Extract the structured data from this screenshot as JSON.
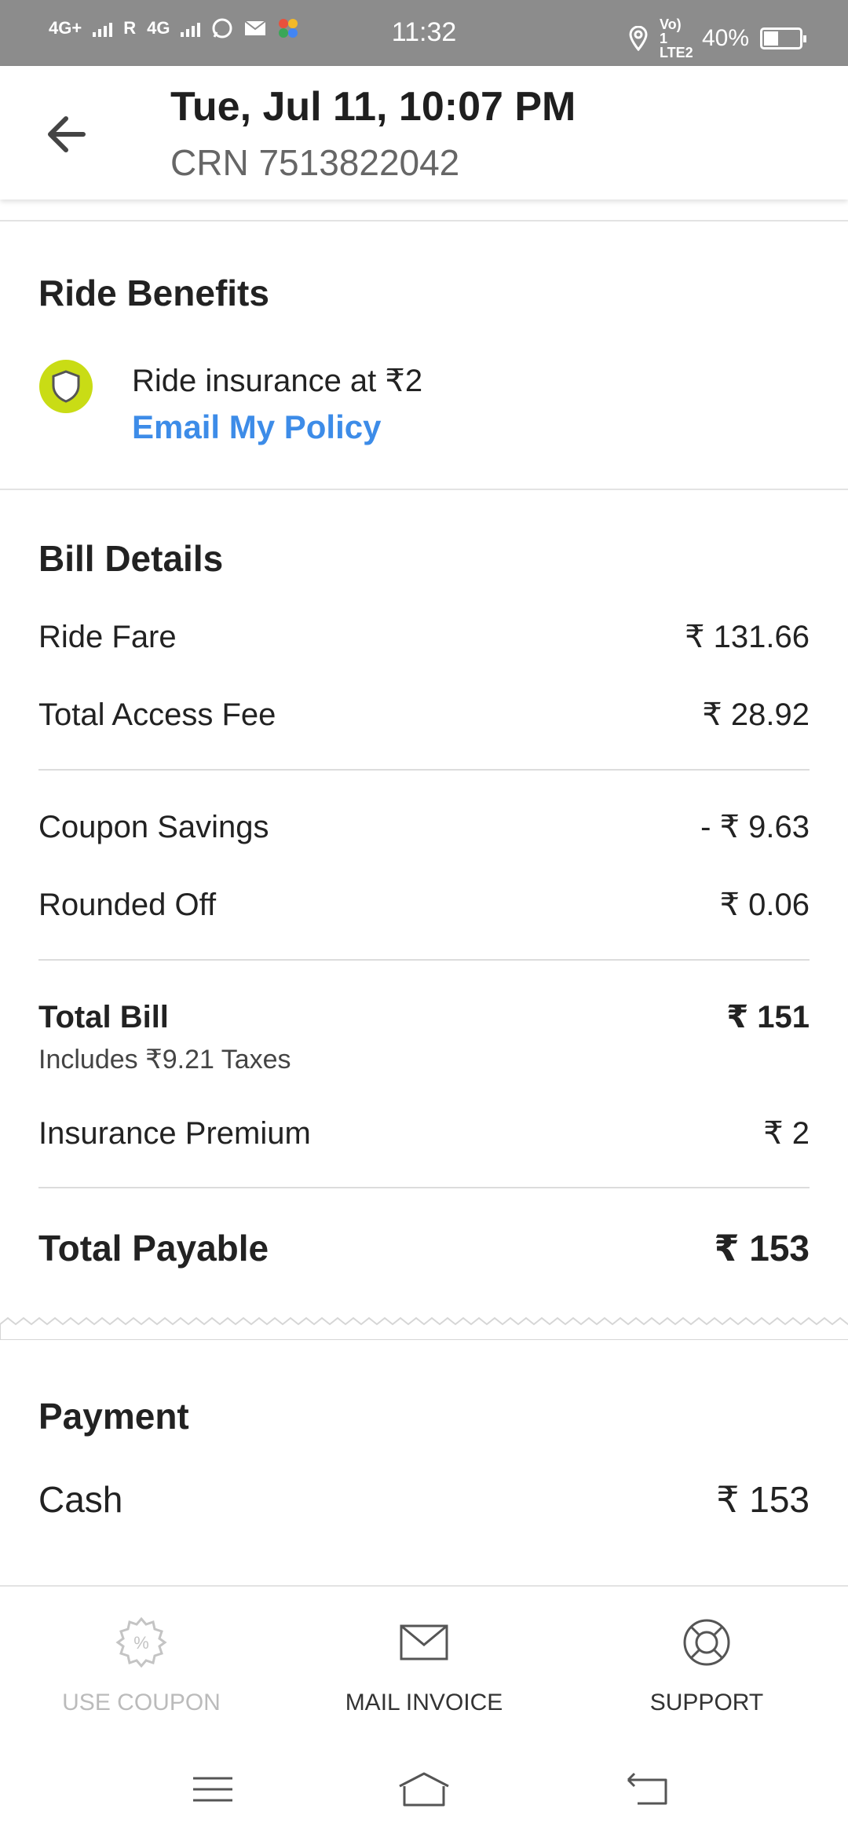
{
  "status_bar": {
    "network_1": "4G+",
    "roaming": "R",
    "network_2": "4G",
    "time": "11:32",
    "volte": "Vo) 1 LTE2",
    "battery_percent": "40%",
    "battery_level": 0.4
  },
  "header": {
    "title": "Tue, Jul 11, 10:07 PM",
    "crn": "CRN 7513822042"
  },
  "ride_benefits": {
    "title": "Ride Benefits",
    "insurance_text": "Ride insurance at ₹2",
    "email_policy_label": "Email My Policy",
    "shield_color": "#c9dc15",
    "link_color": "#3d8ce8"
  },
  "bill": {
    "title": "Bill Details",
    "ride_fare_label": "Ride Fare",
    "ride_fare_value": "₹ 131.66",
    "access_fee_label": "Total Access Fee",
    "access_fee_value": "₹ 28.92",
    "coupon_label": "Coupon Savings",
    "coupon_value": "- ₹ 9.63",
    "rounded_label": "Rounded Off",
    "rounded_value": "₹ 0.06",
    "total_bill_label": "Total Bill",
    "total_bill_value": "₹ 151",
    "taxes_note": "Includes ₹9.21 Taxes",
    "insurance_label": "Insurance Premium",
    "insurance_value": "₹ 2",
    "total_payable_label": "Total Payable",
    "total_payable_value": "₹ 153"
  },
  "payment": {
    "title": "Payment",
    "method": "Cash",
    "amount": "₹ 153"
  },
  "actions": {
    "coupon_label": "USE COUPON",
    "mail_label": "MAIL INVOICE",
    "support_label": "SUPPORT"
  }
}
